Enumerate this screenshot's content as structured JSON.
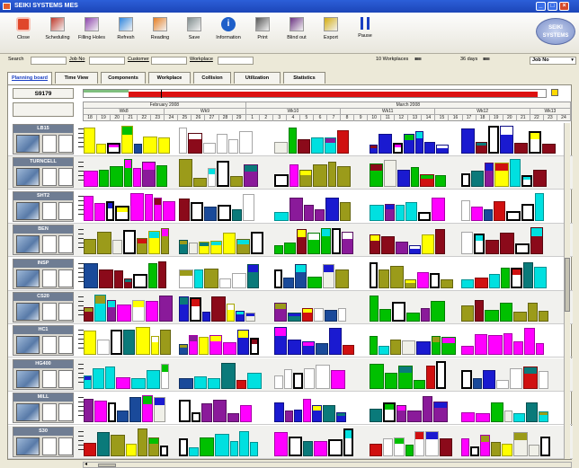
{
  "window": {
    "title": "SEIKI SYSTEMS MES"
  },
  "toolbar": {
    "items": [
      {
        "label": "Close",
        "icon": "close-icon",
        "color": "#e0472a"
      },
      {
        "label": "Scheduling",
        "icon": "scheduling-icon",
        "color": "#c0392b"
      },
      {
        "label": "Filling Holes",
        "icon": "filling-holes-icon",
        "color": "#8e44ad"
      },
      {
        "label": "Refresh",
        "icon": "refresh-icon",
        "color": "#2e86de"
      },
      {
        "label": "Reading",
        "icon": "reading-icon",
        "color": "#e67e22"
      },
      {
        "label": "Save",
        "icon": "save-icon",
        "color": "#7f8c8d"
      },
      {
        "label": "Information",
        "icon": "information-icon",
        "color": "#1e5fc9"
      },
      {
        "label": "Print",
        "icon": "print-icon",
        "color": "#555555"
      },
      {
        "label": "Blind out",
        "icon": "blind-out-icon",
        "color": "#6c3483"
      },
      {
        "label": "Export",
        "icon": "export-icon",
        "color": "#d4ac0d"
      },
      {
        "label": "Pause",
        "icon": "pause-icon",
        "color": "#1a3fc2"
      }
    ],
    "logo_text": "SEIKI SYSTEMS"
  },
  "search": {
    "label": "Search",
    "fields": [
      "Job No",
      "Customer",
      "Workplace"
    ],
    "workplaces": "10 Workplaces",
    "days": "36 days",
    "sort": "Job No"
  },
  "tabs": [
    "Planning board",
    "Time View",
    "Components",
    "Workplace",
    "Collision",
    "Utilization",
    "Statistics"
  ],
  "board": {
    "order_no": "S9179",
    "months": [
      "February 2008",
      "March 2008"
    ],
    "weeks": [
      "Wk8",
      "Wk9",
      "Wk10",
      "Wk11",
      "Wk12",
      "Wk13"
    ],
    "days": [
      "18",
      "19",
      "20",
      "21",
      "22",
      "23",
      "24",
      "25",
      "26",
      "27",
      "28",
      "29",
      "1",
      "2",
      "3",
      "4",
      "5",
      "6",
      "7",
      "8",
      "9",
      "10",
      "11",
      "12",
      "13",
      "14",
      "15",
      "16",
      "17",
      "18",
      "19",
      "20",
      "21",
      "22",
      "23",
      "24"
    ],
    "machines": [
      "LB15",
      "TURNCELL",
      "SHT2",
      "BEN",
      "INSP",
      "CS20",
      "HC1",
      "HG400",
      "MILL",
      "S30"
    ],
    "progress_fraction": 0.98,
    "progress_done_color": "#7fbf7f",
    "progress_color": "#dd1111"
  },
  "colors": {
    "accent": "#1a3fc2",
    "titlebar": "#2456d0"
  }
}
